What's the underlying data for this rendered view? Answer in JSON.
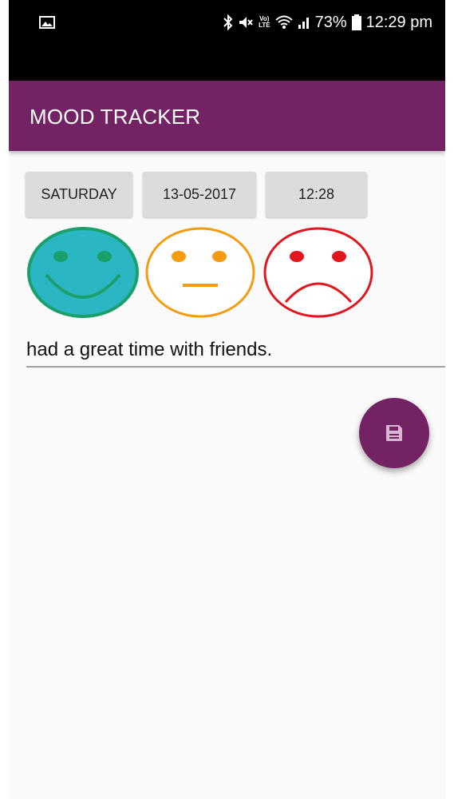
{
  "status_bar": {
    "battery": "73%",
    "time": "12:29 pm",
    "icons": [
      "gallery-icon",
      "bluetooth-icon",
      "mute-icon",
      "volte-icon",
      "wifi-icon",
      "signal-icon",
      "battery-icon"
    ]
  },
  "app_bar": {
    "title": "MOOD TRACKER",
    "color": "#732364"
  },
  "chips": {
    "day": "SATURDAY",
    "date": "13-05-2017",
    "time": "12:28"
  },
  "moods": [
    {
      "name": "happy-face-icon",
      "color": "#1aa06a",
      "fill": "#2ab6c2"
    },
    {
      "name": "neutral-face-icon",
      "color": "#f39c12"
    },
    {
      "name": "sad-face-icon",
      "color": "#e0171f"
    }
  ],
  "note": {
    "value": "had a great time with friends."
  },
  "fab": {
    "icon": "save-icon"
  }
}
